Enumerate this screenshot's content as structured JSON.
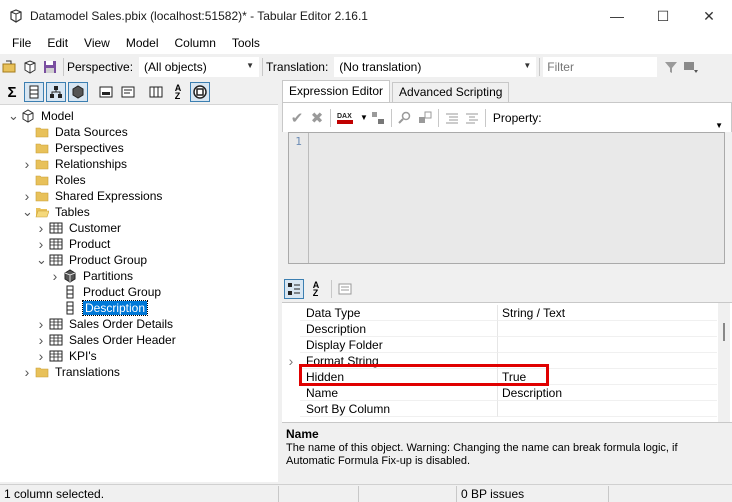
{
  "window": {
    "title": "Datamodel Sales.pbix (localhost:51582)* - Tabular Editor 2.16.1",
    "minimize": "—",
    "maximize": "☐",
    "close": "✕"
  },
  "menu": [
    "File",
    "Edit",
    "View",
    "Model",
    "Column",
    "Tools"
  ],
  "toolbar": {
    "perspective_label": "Perspective:",
    "perspective_value": "(All objects)",
    "translation_label": "Translation:",
    "translation_value": "(No translation)",
    "filter_placeholder": "Filter"
  },
  "tree": {
    "items": [
      {
        "label": "Model",
        "depth": 0,
        "expander": "v",
        "icon": "model-icon"
      },
      {
        "label": "Data Sources",
        "depth": 1,
        "expander": "",
        "icon": "folder-icon"
      },
      {
        "label": "Perspectives",
        "depth": 1,
        "expander": "",
        "icon": "folder-icon"
      },
      {
        "label": "Relationships",
        "depth": 1,
        "expander": ">",
        "icon": "folder-icon"
      },
      {
        "label": "Roles",
        "depth": 1,
        "expander": "",
        "icon": "folder-icon"
      },
      {
        "label": "Shared Expressions",
        "depth": 1,
        "expander": ">",
        "icon": "folder-icon"
      },
      {
        "label": "Tables",
        "depth": 1,
        "expander": "v",
        "icon": "folder-open-icon"
      },
      {
        "label": "Customer",
        "depth": 2,
        "expander": ">",
        "icon": "table-icon"
      },
      {
        "label": "Product",
        "depth": 2,
        "expander": ">",
        "icon": "table-icon"
      },
      {
        "label": "Product Group",
        "depth": 2,
        "expander": "v",
        "icon": "table-icon"
      },
      {
        "label": "Partitions",
        "depth": 3,
        "expander": ">",
        "icon": "partition-icon"
      },
      {
        "label": "Product Group",
        "depth": 3,
        "expander": "",
        "icon": "column-icon"
      },
      {
        "label": "Description",
        "depth": 3,
        "expander": "",
        "icon": "column-icon",
        "selected": true
      },
      {
        "label": "Sales Order Details",
        "depth": 2,
        "expander": ">",
        "icon": "table-icon"
      },
      {
        "label": "Sales Order Header",
        "depth": 2,
        "expander": ">",
        "icon": "table-icon"
      },
      {
        "label": "KPI's",
        "depth": 2,
        "expander": ">",
        "icon": "table-icon"
      },
      {
        "label": "Translations",
        "depth": 1,
        "expander": ">",
        "icon": "folder-icon"
      }
    ]
  },
  "tabs": [
    {
      "label": "Expression Editor",
      "active": true
    },
    {
      "label": "Advanced Scripting",
      "active": false
    }
  ],
  "editor": {
    "property_label": "Property:",
    "line_number": "1",
    "dax_label": "DAX"
  },
  "properties": {
    "rows": [
      {
        "name": "Data Type",
        "value": "String / Text",
        "expander": ""
      },
      {
        "name": "Description",
        "value": "",
        "expander": ""
      },
      {
        "name": "Display Folder",
        "value": "",
        "expander": ""
      },
      {
        "name": "Format String",
        "value": "",
        "expander": ">"
      },
      {
        "name": "Hidden",
        "value": "True",
        "expander": ""
      },
      {
        "name": "Name",
        "value": "Description",
        "expander": ""
      },
      {
        "name": "Sort By Column",
        "value": "",
        "expander": ""
      }
    ]
  },
  "description_panel": {
    "title": "Name",
    "text": "The name of this object. Warning: Changing the name can break formula logic, if Automatic Formula Fix-up is disabled."
  },
  "status": {
    "selection": "1 column selected.",
    "bp_issues": "0 BP issues"
  },
  "colors": {
    "selection": "#0078d7",
    "highlight_box": "#e00000",
    "folder": "#e8c15a"
  }
}
